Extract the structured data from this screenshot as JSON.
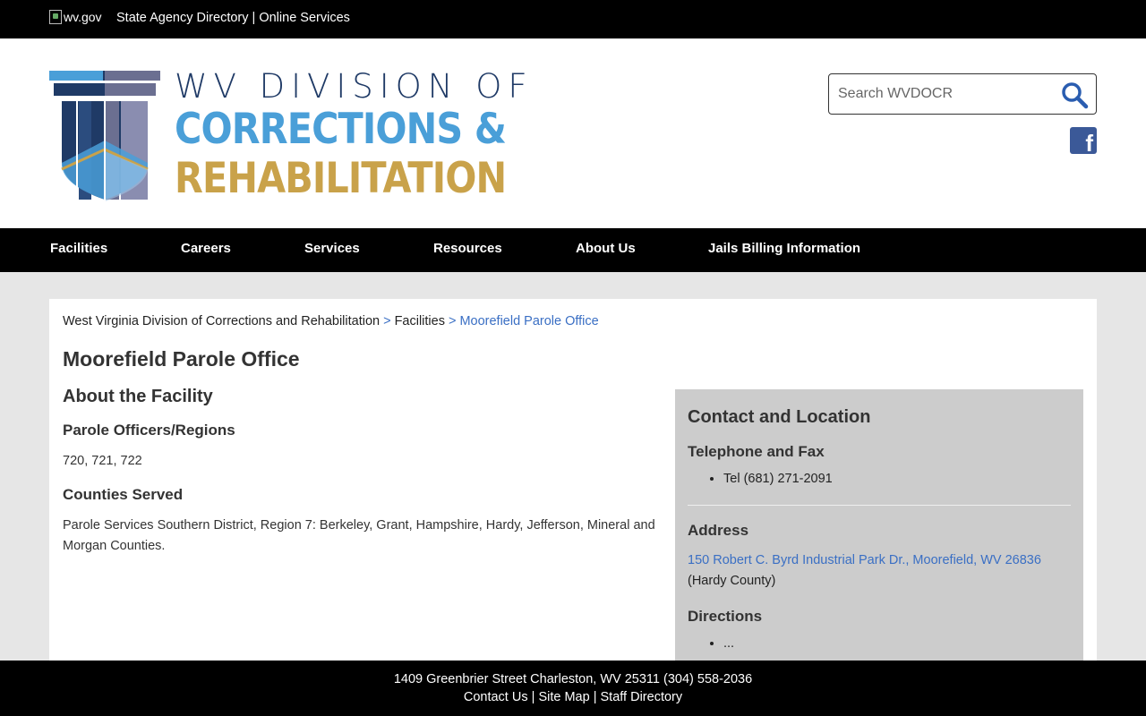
{
  "topbar": {
    "wv_logo_alt": "wv.gov",
    "agency_directory": "State Agency Directory",
    "separator": "|",
    "online_services": "Online Services"
  },
  "logo": {
    "line1": "WV DIVISION OF",
    "line2": "CORRECTIONS &",
    "line3": "REHABILITATION",
    "colors": {
      "navy": "#1f3a66",
      "blue": "#4a9fd8",
      "gold": "#c9a24a"
    }
  },
  "search": {
    "placeholder": "Search WVDOCR"
  },
  "social": {
    "facebook_icon": "facebook-icon"
  },
  "nav": {
    "items": [
      "Facilities",
      "Careers",
      "Services",
      "Resources",
      "About Us",
      "Jails Billing Information"
    ]
  },
  "breadcrumb": {
    "root": "West Virginia Division of Corrections and Rehabilitation",
    "sep": ">",
    "section": "Facilities",
    "current": "Moorefield Parole Office"
  },
  "page": {
    "title": "Moorefield Parole Office",
    "about_heading": "About the Facility",
    "officers_heading": "Parole Officers/Regions",
    "officers_value": "720, 721, 722",
    "counties_heading": "Counties Served",
    "counties_value": "Parole Services Southern District, Region 7: Berkeley, Grant, Hampshire, Hardy, Jefferson, Mineral and Morgan Counties."
  },
  "contact": {
    "heading": "Contact and Location",
    "phone_heading": "Telephone and Fax",
    "phone_items": [
      "Tel (681) 271-2091"
    ],
    "address_heading": "Address",
    "address_link": "150 Robert C. Byrd Industrial Park Dr., Moorefield, WV 26836",
    "address_county": "(Hardy County)",
    "directions_heading": "Directions",
    "directions_items": [
      "..."
    ]
  },
  "footer": {
    "address": "1409 Greenbrier Street Charleston, WV 25311 (304) 558-2036",
    "contact_us": "Contact Us",
    "sep": "|",
    "site_map": "Site Map",
    "staff_directory": "Staff Directory"
  }
}
